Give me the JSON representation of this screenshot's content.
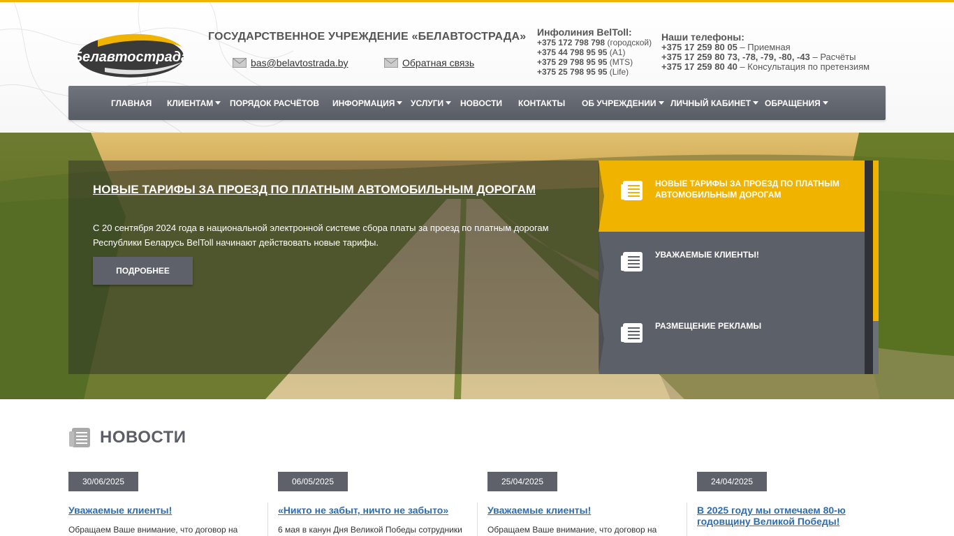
{
  "header": {
    "logo_text": "Белавтострада",
    "org_title": "ГОСУДАРСТВЕННОЕ УЧРЕЖДЕНИЕ «БЕЛАВТОСТРАДА»",
    "email": "bas@belavtostrada.by",
    "feedback": "Обратная связь",
    "infoline": {
      "title": "Инфолиния BelToll:",
      "lines": [
        {
          "number": "+375 172 798 798",
          "note": "(городской)"
        },
        {
          "number": "+375 44 798 95 95",
          "note": "(A1)"
        },
        {
          "number": "+375 29 798 95 95",
          "note": "(MTS)"
        },
        {
          "number": "+375 25 798 95 95",
          "note": "(Life)"
        }
      ]
    },
    "phones": {
      "title": "Наши телефоны:",
      "lines": [
        {
          "number": "+375 17 259 80 05",
          "note": " – Приемная"
        },
        {
          "number": "+375 17 259 80 73, -78, -79, -80, -43",
          "note": " – Расчёты"
        },
        {
          "number": "+375 17 259 80 40",
          "note": " – Консультация по претензиям"
        }
      ]
    }
  },
  "nav": {
    "items": [
      {
        "label": "ГЛАВНАЯ",
        "dropdown": false
      },
      {
        "label": "КЛИЕНТАМ",
        "dropdown": true
      },
      {
        "label": "ПОРЯДОК РАСЧЁТОВ",
        "dropdown": false
      },
      {
        "label": "ИНФОРМАЦИЯ",
        "dropdown": true
      },
      {
        "label": "УСЛУГИ",
        "dropdown": true
      },
      {
        "label": "НОВОСТИ",
        "dropdown": false
      },
      {
        "label": "КОНТАКТЫ",
        "dropdown": false
      },
      {
        "label": "ОБ УЧРЕЖДЕНИИ",
        "dropdown": true
      },
      {
        "label": "ЛИЧНЫЙ КАБИНЕТ",
        "dropdown": true
      },
      {
        "label": "ОБРАЩЕНИЯ",
        "dropdown": true
      }
    ]
  },
  "slider": {
    "title": "НОВЫЕ ТАРИФЫ ЗА ПРОЕЗД ПО ПЛАТНЫМ АВТОМОБИЛЬНЫМ ДОРОГАМ",
    "text": "С 20 сентября 2024 года в национальной электронной системе сбора платы за проезд по платным дорогам Республики Беларусь BelToll начинают действовать новые тарифы.",
    "button": "ПОДРОБНЕЕ",
    "tabs": [
      {
        "label": "НОВЫЕ ТАРИФЫ ЗА ПРОЕЗД ПО ПЛАТНЫМ АВТОМОБИЛЬНЫМ ДОРОГАМ",
        "active": true
      },
      {
        "label": "УВАЖАЕМЫЕ КЛИЕНТЫ!",
        "active": false
      },
      {
        "label": "РАЗМЕЩЕНИЕ РЕКЛАМЫ",
        "active": false
      }
    ]
  },
  "news": {
    "heading": "НОВОСТИ",
    "items": [
      {
        "date": "30/06/2025",
        "title": "Уважаемые клиенты!",
        "excerpt": "Обращаем Ваше внимание, что договор на"
      },
      {
        "date": "06/05/2025",
        "title": "«Никто не забыт, ничто не забыто»",
        "excerpt": "6 мая в канун Дня Великой Победы сотрудники"
      },
      {
        "date": "25/04/2025",
        "title": "Уважаемые клиенты!",
        "excerpt": "Обращаем Ваше внимание, что договор на"
      },
      {
        "date": "24/04/2025",
        "title_line1": "В 2025 году мы отмечаем 80-ю",
        "title_line2": "годовщину Великой Победы!"
      }
    ]
  },
  "colors": {
    "accent": "#f0b400",
    "nav_bg": "#62666e",
    "link": "#2a6db5"
  }
}
